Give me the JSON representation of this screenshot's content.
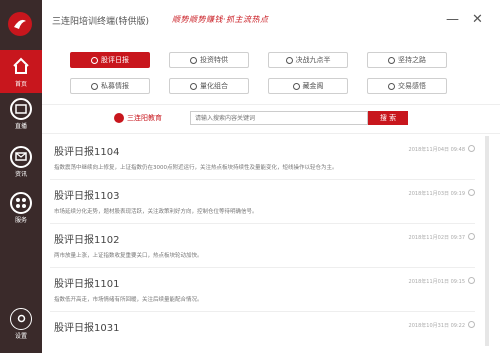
{
  "window": {
    "title": "三连阳培训终端(特供版)",
    "slogan": "顺势顺势赚钱·抓主流热点",
    "minimize": "—",
    "close": "✕"
  },
  "sidebar": {
    "items": [
      {
        "label": "首页",
        "icon": "home-icon"
      },
      {
        "label": "直播",
        "icon": "live-icon"
      },
      {
        "label": "资讯",
        "icon": "message-icon"
      },
      {
        "label": "服务",
        "icon": "apps-icon"
      },
      {
        "label": "设置",
        "icon": "settings-icon"
      }
    ]
  },
  "categories": [
    {
      "label": "股评日报",
      "active": true
    },
    {
      "label": "投资特供"
    },
    {
      "label": "决战九点半"
    },
    {
      "label": "坚持之路"
    },
    {
      "label": "私募情报"
    },
    {
      "label": "量化组合"
    },
    {
      "label": "藏金阁"
    },
    {
      "label": "交易感悟"
    }
  ],
  "search": {
    "brand": "三连阳教育",
    "placeholder": "请输入搜索内容关键词",
    "button": "搜 索"
  },
  "articles": [
    {
      "title": "股评日报1104",
      "desc": "指数震荡中继续向上修复，上证指数仍在3000点附近运行，关注热点板块持续性及量能变化，短线操作以轻仓为主。",
      "time": "2018年11月04日 09:48"
    },
    {
      "title": "股评日报1103",
      "desc": "市场延续分化走势，题材股表现活跃，关注政策利好方向，控制仓位等待明确信号。",
      "time": "2018年11月03日 09:19"
    },
    {
      "title": "股评日报1102",
      "desc": "两市放量上涨，上证指数收复重要关口，热点板块轮动加快。",
      "time": "2018年11月02日 09:37"
    },
    {
      "title": "股评日报1101",
      "desc": "指数低开高走，市场情绪有所回暖，关注后续量能配合情况。",
      "time": "2018年11月01日 09:15"
    },
    {
      "title": "股评日报1031",
      "desc": "",
      "time": "2018年10月31日 09:22"
    }
  ],
  "colors": {
    "accent": "#c8161d",
    "sidebar": "#3a2a2a"
  }
}
